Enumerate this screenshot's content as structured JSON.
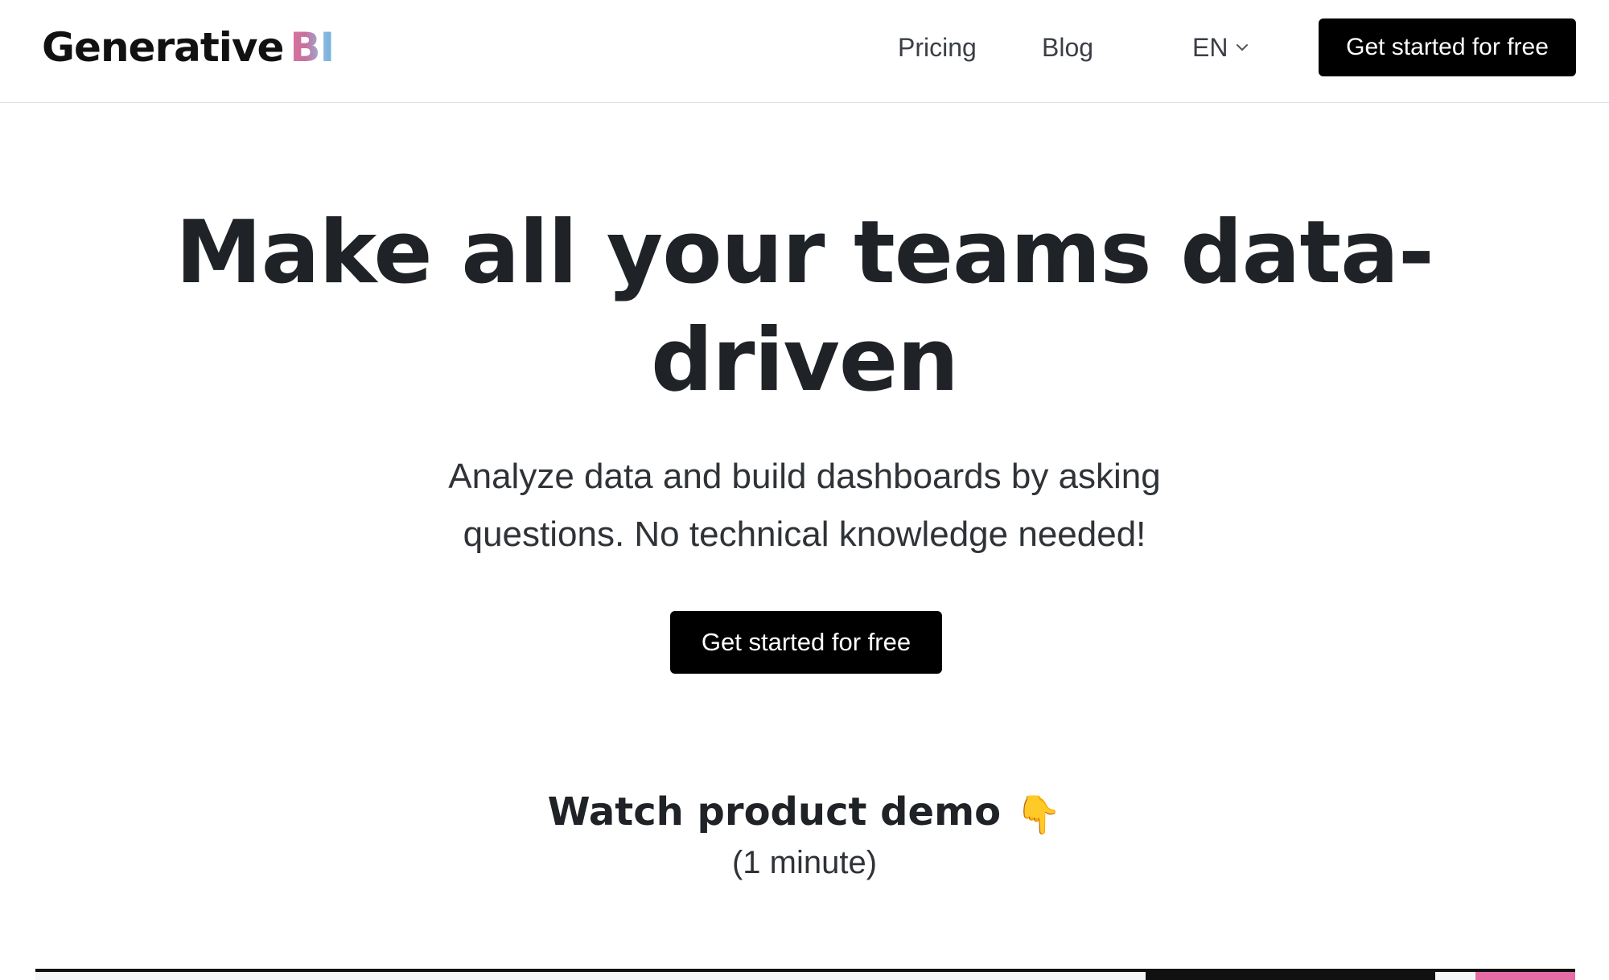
{
  "header": {
    "logo": {
      "main": "Generative",
      "accent": "BI"
    },
    "nav": [
      {
        "label": "Pricing"
      },
      {
        "label": "Blog"
      }
    ],
    "language": {
      "label": "EN",
      "icon": "chevron-down-icon"
    },
    "cta_label": "Get started for free"
  },
  "hero": {
    "title": "Make all your teams data-driven",
    "subtitle": "Analyze data and build dashboards by asking questions. No technical knowledge needed!",
    "cta_label": "Get started for free"
  },
  "demo": {
    "title": "Watch product demo",
    "icon": "pointing-down-icon",
    "icon_glyph": "👇",
    "duration": "(1 minute)"
  },
  "colors": {
    "accent_pink": "#d9769c",
    "accent_blue": "#6bb0e6",
    "button_bg": "#000000",
    "button_text": "#ffffff"
  }
}
